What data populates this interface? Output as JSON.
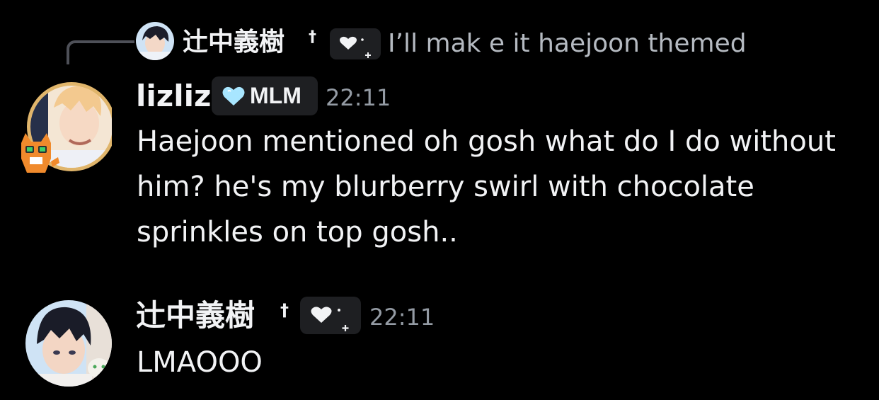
{
  "reply": {
    "author": "辻中義樹",
    "dagger": "†",
    "tag_icon": "white-heart-sparkle-icon",
    "preview_text": "I’ll mak e it haejoon themed"
  },
  "messages": [
    {
      "author": "lizliz",
      "badge": {
        "icon": "light-blue-heart-icon",
        "label": "MLM",
        "icon_color": "#a8e6ff"
      },
      "timestamp": "22:11",
      "lines": [
        "Haejoon mentioned oh gosh what do I do without",
        "him? he's my blurberry swirl with chocolate",
        "sprinkles on top gosh.."
      ]
    },
    {
      "author": "辻中義樹",
      "dagger": "†",
      "tag_icon": "white-heart-sparkle-icon",
      "timestamp": "22:11",
      "text": "LMAOOO"
    }
  ],
  "colors": {
    "background": "#000000",
    "text": "#f2f3f5",
    "muted": "#949ba4",
    "tag_bg": "#1e1f22"
  }
}
